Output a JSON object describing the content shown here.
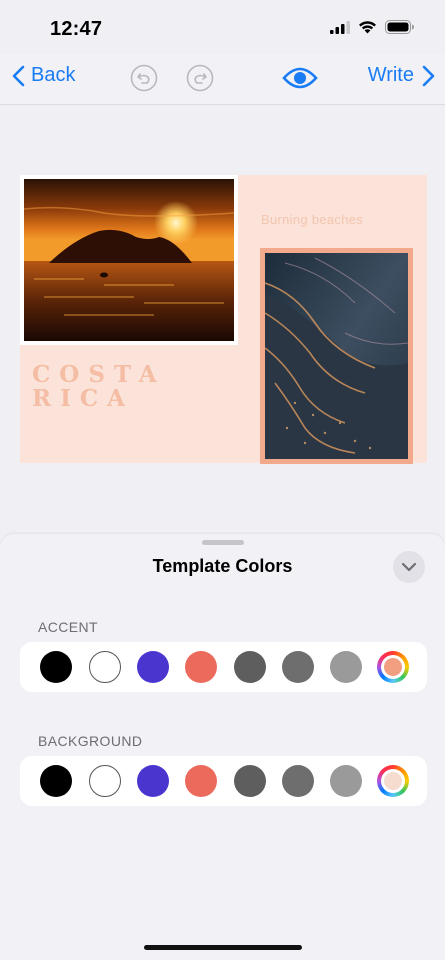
{
  "status": {
    "time": "12:47"
  },
  "nav": {
    "back_label": "Back",
    "write_label": "Write",
    "accent_color": "#1a7cf5"
  },
  "template": {
    "title_line1": "COSTA",
    "title_line2": "RICA",
    "caption": "Burning beaches"
  },
  "sheet": {
    "title": "Template Colors",
    "accent_label": "ACCENT",
    "background_label": "BACKGROUND",
    "accent_swatches": [
      "#000000",
      "#ffffff",
      "#4a35cf",
      "#ec6a5c",
      "#5e5e5e",
      "#6e6e6e",
      "#9a9a9a",
      "custom"
    ],
    "accent_custom_color": "#f29e80",
    "background_swatches": [
      "#000000",
      "#ffffff",
      "#4a35cf",
      "#ec6a5c",
      "#5e5e5e",
      "#6e6e6e",
      "#9a9a9a",
      "custom"
    ],
    "background_custom_color": "#f6dbcf"
  },
  "icons": [
    "back-chevron-icon",
    "undo-icon",
    "redo-icon",
    "eye-icon",
    "forward-chevron-icon",
    "chevron-down-icon",
    "signal-icon",
    "wifi-icon",
    "battery-icon"
  ]
}
